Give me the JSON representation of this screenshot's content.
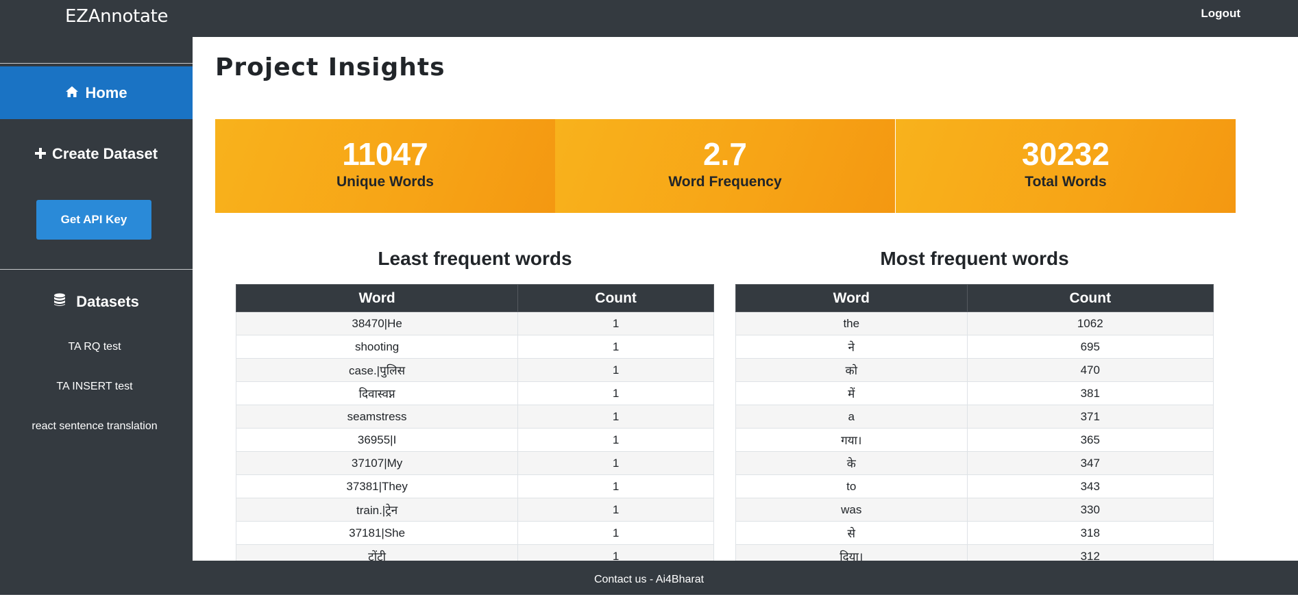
{
  "app": {
    "brand": "EZAnnotate",
    "logout_label": "Logout"
  },
  "sidebar": {
    "home_label": "Home",
    "create_label": "Create Dataset",
    "api_key_label": "Get API Key",
    "datasets_label": "Datasets",
    "datasets": [
      "TA RQ test",
      "TA INSERT test",
      "react sentence translation"
    ]
  },
  "page": {
    "title": "Project Insights"
  },
  "stats": [
    {
      "value": "11047",
      "label": "Unique Words"
    },
    {
      "value": "2.7",
      "label": "Word Frequency"
    },
    {
      "value": "30232",
      "label": "Total Words"
    }
  ],
  "least_frequent": {
    "title": "Least frequent words",
    "columns": [
      "Word",
      "Count"
    ],
    "rows": [
      [
        "38470|He",
        "1"
      ],
      [
        "shooting",
        "1"
      ],
      [
        "case.|पुलिस",
        "1"
      ],
      [
        "दिवास्वप्न",
        "1"
      ],
      [
        "seamstress",
        "1"
      ],
      [
        "36955|I",
        "1"
      ],
      [
        "37107|My",
        "1"
      ],
      [
        "37381|They",
        "1"
      ],
      [
        "train.|ट्रेन",
        "1"
      ],
      [
        "37181|She",
        "1"
      ],
      [
        "टोंटी",
        "1"
      ]
    ]
  },
  "most_frequent": {
    "title": "Most frequent words",
    "columns": [
      "Word",
      "Count"
    ],
    "rows": [
      [
        "the",
        "1062"
      ],
      [
        "ने",
        "695"
      ],
      [
        "को",
        "470"
      ],
      [
        "में",
        "381"
      ],
      [
        "a",
        "371"
      ],
      [
        "गया।",
        "365"
      ],
      [
        "के",
        "347"
      ],
      [
        "to",
        "343"
      ],
      [
        "was",
        "330"
      ],
      [
        "से",
        "318"
      ],
      [
        "दिया।",
        "312"
      ]
    ]
  },
  "footer": {
    "text": "Contact us - Ai4Bharat"
  },
  "colors": {
    "navbar": "#343a40",
    "active_nav": "#1a73c4",
    "api_button": "#2a8ad8",
    "stat_card": "#f7a416"
  }
}
